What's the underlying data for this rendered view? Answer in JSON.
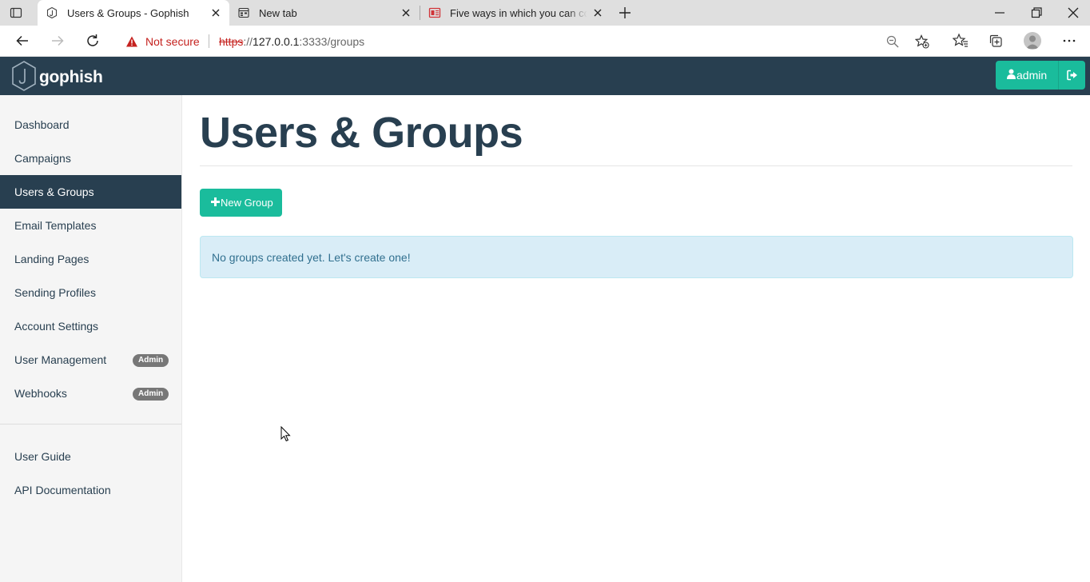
{
  "browser": {
    "tabs": [
      {
        "title": "Users & Groups - Gophish",
        "active": true,
        "icon": "gophish-favicon-icon"
      },
      {
        "title": "New tab",
        "active": false,
        "icon": "new-tab-page-icon"
      },
      {
        "title": "Five ways in which you can comb",
        "active": false,
        "icon": "news-favicon-icon"
      }
    ],
    "address": {
      "security_label": "Not secure",
      "url_scheme": "https",
      "url_host": "127.0.0.1",
      "url_rest": ":3333/groups"
    }
  },
  "app": {
    "brand": "gophish",
    "user_button_label": "admin",
    "sidebar": {
      "items": [
        {
          "label": "Dashboard",
          "active": false
        },
        {
          "label": "Campaigns",
          "active": false
        },
        {
          "label": "Users & Groups",
          "active": true
        },
        {
          "label": "Email Templates",
          "active": false
        },
        {
          "label": "Landing Pages",
          "active": false
        },
        {
          "label": "Sending Profiles",
          "active": false
        },
        {
          "label": "Account Settings",
          "active": false
        },
        {
          "label": "User Management",
          "active": false,
          "badge": "Admin"
        },
        {
          "label": "Webhooks",
          "active": false,
          "badge": "Admin"
        }
      ],
      "footer_items": [
        {
          "label": "User Guide"
        },
        {
          "label": "API Documentation"
        }
      ]
    },
    "main": {
      "title": "Users & Groups",
      "new_group_label": "New Group",
      "empty_message": "No groups created yet. Let's create one!"
    }
  },
  "colors": {
    "navbar": "#283f50",
    "accent": "#1abc9c",
    "alert_bg": "#d9edf7",
    "alert_text": "#31708f"
  }
}
